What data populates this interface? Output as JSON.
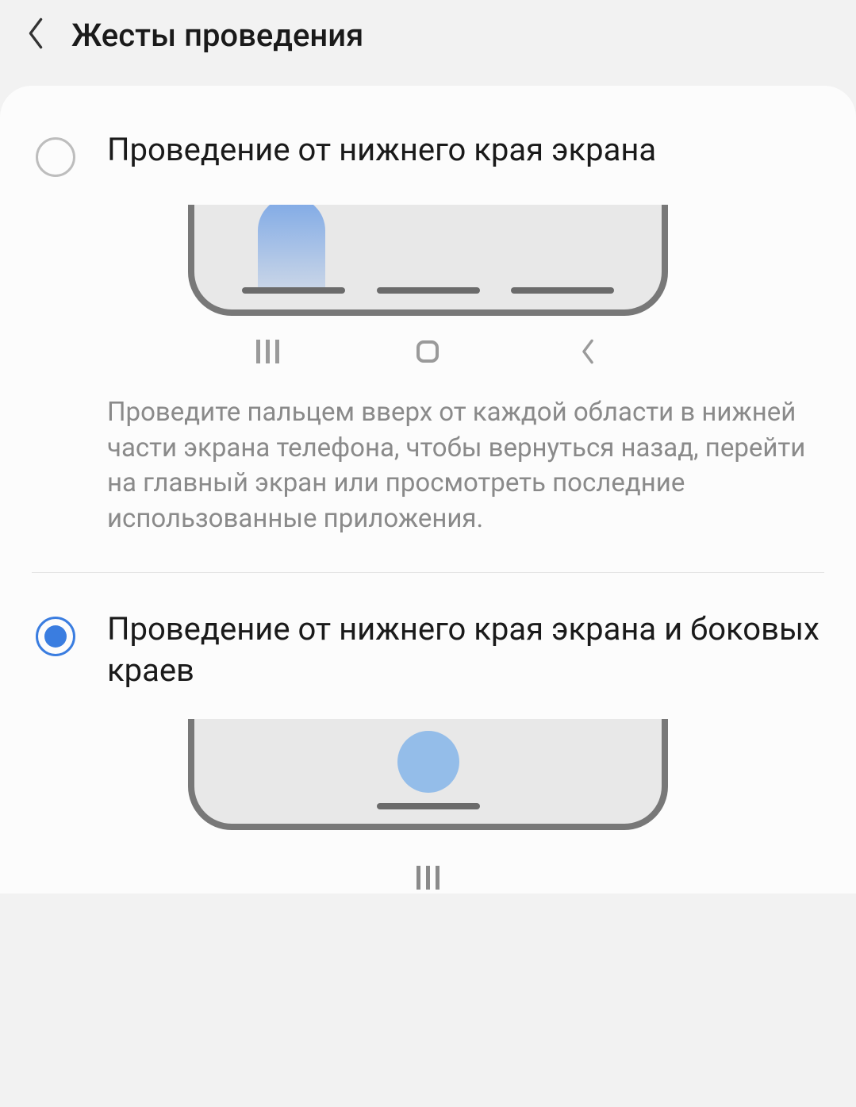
{
  "header": {
    "title": "Жесты проведения"
  },
  "options": [
    {
      "label": "Проведение от нижнего края экрана",
      "description": "Проведите пальцем вверх от каждой области в нижней части экрана телефона, чтобы вернуться назад, перейти на главный экран или просмотреть последние использованные приложения.",
      "selected": false
    },
    {
      "label": "Проведение от нижнего края экрана и боковых краев",
      "selected": true
    }
  ]
}
